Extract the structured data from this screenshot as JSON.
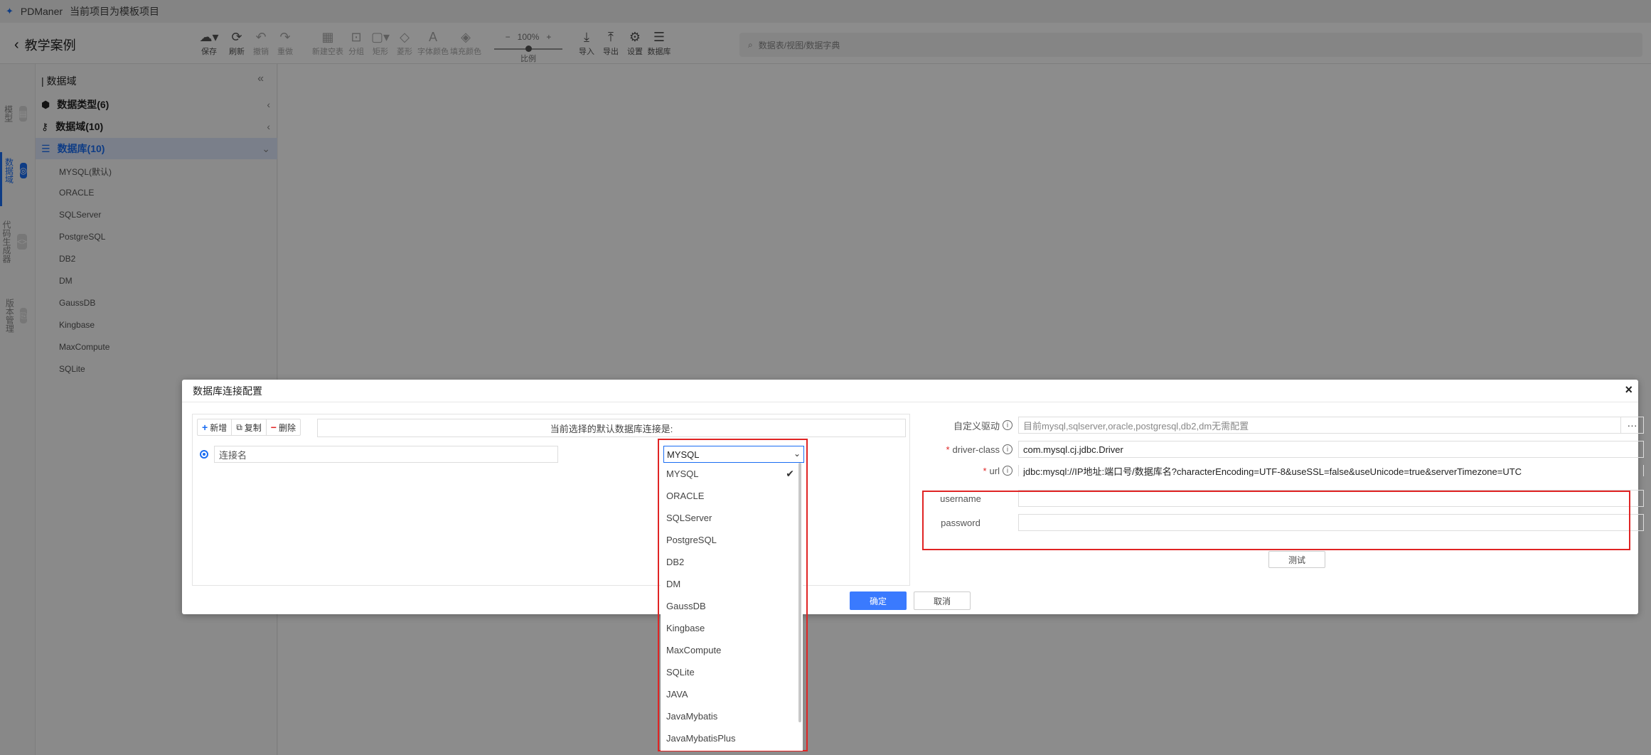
{
  "app": {
    "name": "PDManer",
    "project_status": "当前项目为模板项目",
    "back_label": "教学案例"
  },
  "toolbar": {
    "save": "保存",
    "refresh": "刷新",
    "undo": "撤销",
    "redo": "重做",
    "new_blank": "新建空表",
    "group": "分组",
    "rect": "矩形",
    "shape": "菱形",
    "font_color": "字体颜色",
    "fill_color": "填充颜色",
    "zoom_value": "100%",
    "zoom_label": "比例",
    "import": "导入",
    "export": "导出",
    "settings": "设置",
    "database": "数据库",
    "search_placeholder": "数据表/视图/数据字典"
  },
  "rail": {
    "model": "模型",
    "domain": "数据域",
    "codegen": "代码生成器",
    "version": "版本管理"
  },
  "sidebar": {
    "title": "数据域",
    "items": [
      {
        "label": "数据类型(6)"
      },
      {
        "label": "数据域(10)"
      },
      {
        "label": "数据库(10)"
      }
    ],
    "databases": [
      "MYSQL(默认)",
      "ORACLE",
      "SQLServer",
      "PostgreSQL",
      "DB2",
      "DM",
      "GaussDB",
      "Kingbase",
      "MaxCompute",
      "SQLite"
    ]
  },
  "modal": {
    "title": "数据库连接配置",
    "left": {
      "add": "新增",
      "copy": "复制",
      "delete": "删除",
      "default_text": "当前选择的默认数据库连接是:",
      "connection_placeholder": "连接名"
    },
    "select": {
      "value": "MYSQL",
      "options": [
        "MYSQL",
        "ORACLE",
        "SQLServer",
        "PostgreSQL",
        "DB2",
        "DM",
        "GaussDB",
        "Kingbase",
        "MaxCompute",
        "SQLite",
        "JAVA",
        "JavaMybatis",
        "JavaMybatisPlus"
      ]
    },
    "right": {
      "custom_driver_label": "自定义驱动",
      "custom_driver_placeholder": "目前mysql,sqlserver,oracle,postgresql,db2,dm无需配置",
      "more": "···",
      "driver_class_label": "driver-class",
      "driver_class_value": "com.mysql.cj.jdbc.Driver",
      "url_label": "url",
      "url_value": "jdbc:mysql://IP地址:端口号/数据库名?characterEncoding=UTF-8&useSSL=false&useUnicode=true&serverTimezone=UTC",
      "username_label": "username",
      "username_value": "",
      "password_label": "password",
      "password_value": "",
      "test_button": "测试"
    },
    "ok": "确定",
    "cancel": "取消",
    "close": "×"
  },
  "highlight_color": "#e02424",
  "accent_color": "#1a6df2"
}
